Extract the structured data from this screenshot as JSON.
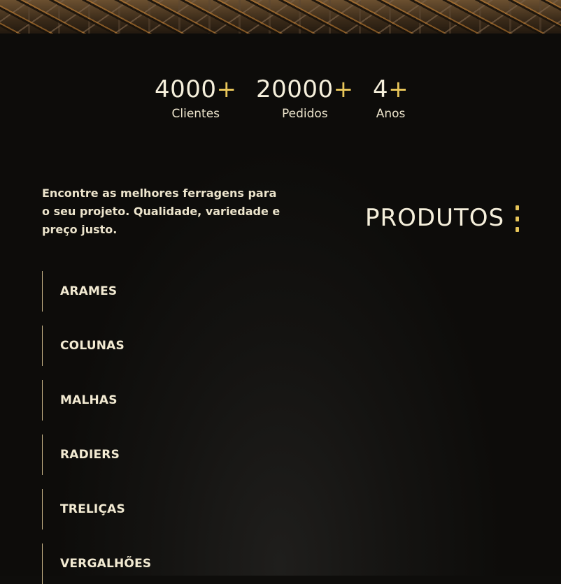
{
  "stats": [
    {
      "value": "4000",
      "suffix": "+",
      "label": "Clientes"
    },
    {
      "value": "20000",
      "suffix": "+",
      "label": "Pedidos"
    },
    {
      "value": "4",
      "suffix": "+",
      "label": "Anos"
    }
  ],
  "intro": "Encontre as melhores ferragens para o seu projeto. Qualidade, variedade e preço justo.",
  "section_title": "PRODUTOS",
  "products": [
    "ARAMES",
    "COLUNAS",
    "MALHAS",
    "RADIERS",
    "TRELIÇAS",
    "VERGALHÕES"
  ],
  "colors": {
    "accent": "#e8c65a",
    "background": "#0e0d0b",
    "text": "#f2ead2"
  },
  "icons": {
    "menu": "kebab-icon"
  }
}
